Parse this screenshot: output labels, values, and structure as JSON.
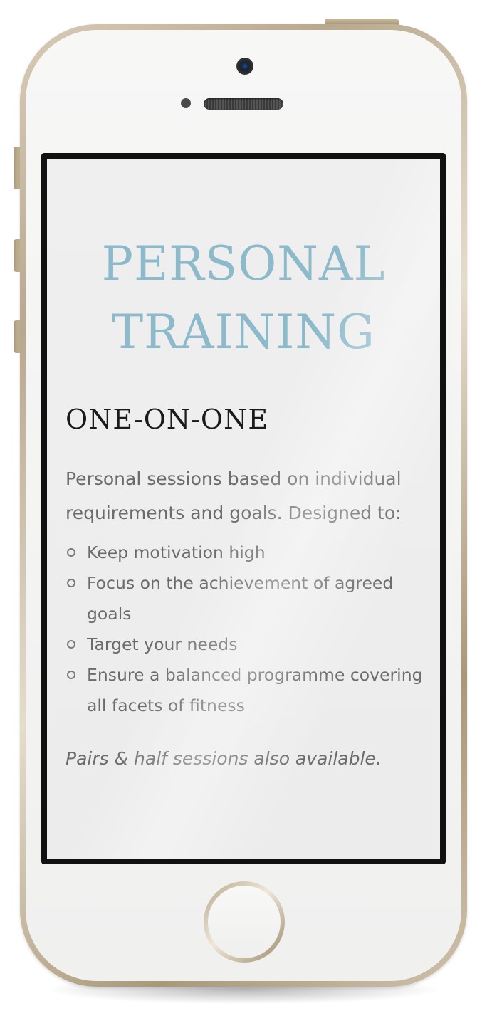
{
  "screen": {
    "page_title_line1": "PERSONAL",
    "page_title_line2": "TRAINING",
    "section_heading": "ONE-ON-ONE",
    "intro": "Personal sessions based on individual requirements and goals. Designed to:",
    "bullets": [
      "Keep motivation high",
      "Focus on the achievement of agreed goals",
      "Target your needs",
      "Ensure a balanced programme covering all facets of fitness"
    ],
    "note": "Pairs & half sessions also available."
  },
  "colors": {
    "title_accent": "#8dbacb",
    "heading": "#1a1a1a",
    "body_text": "#6b6b6b",
    "phone_frame": "#c9b99b"
  },
  "icons": [
    "camera-icon",
    "speaker-icon",
    "home-button-icon"
  ]
}
